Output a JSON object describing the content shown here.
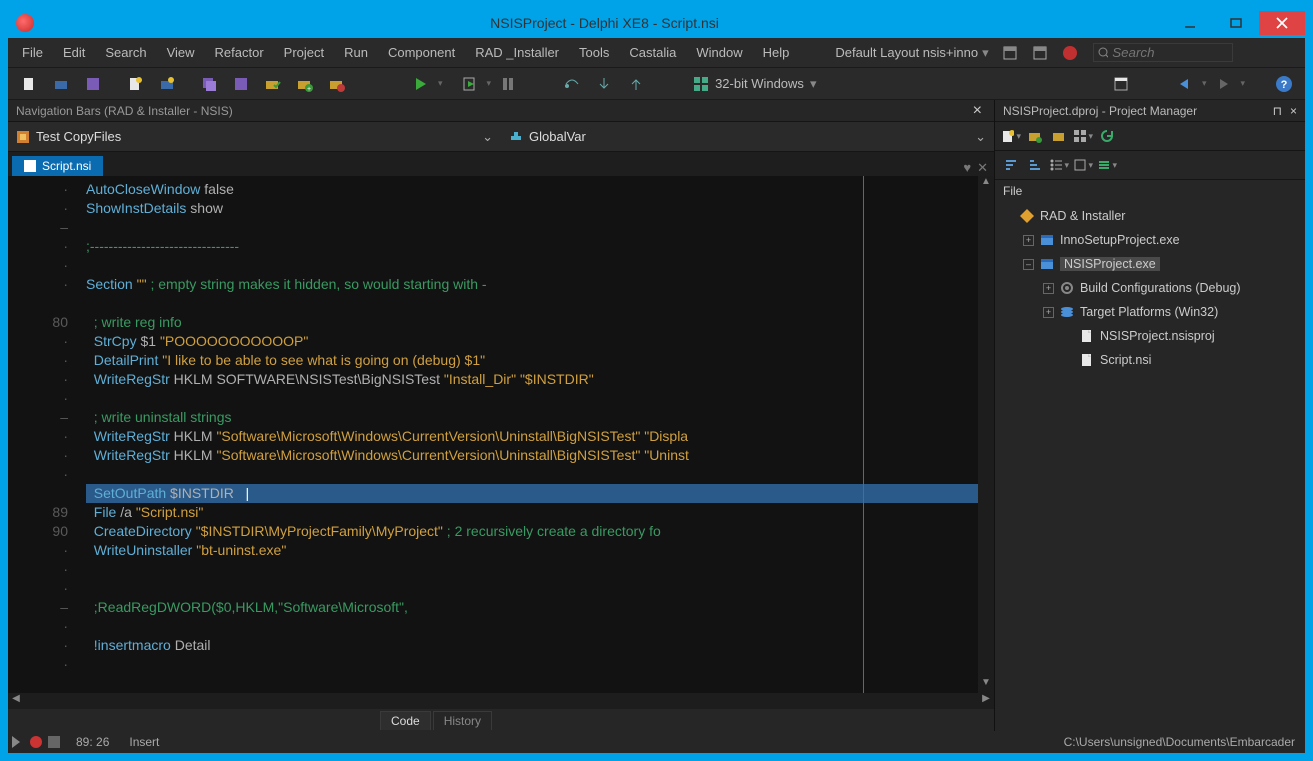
{
  "window": {
    "title": "NSISProject - Delphi XE8 - Script.nsi"
  },
  "menu": [
    "File",
    "Edit",
    "Search",
    "View",
    "Refactor",
    "Project",
    "Run",
    "Component",
    "RAD _Installer",
    "Tools",
    "Castalia",
    "Window",
    "Help"
  ],
  "layout_combo": "Default Layout nsis+inno",
  "search_placeholder": "Search",
  "platform": "32-bit Windows",
  "nav_panel_title": "Navigation Bars (RAD & Installer - NSIS)",
  "nav_left": "Test CopyFiles",
  "nav_right": "GlobalVar",
  "active_tab": "Script.nsi",
  "gutter": [
    "·",
    "·",
    "–",
    "·",
    "·",
    "·",
    "",
    "80",
    "·",
    "·",
    "·",
    "·",
    "–",
    "·",
    "·",
    "·",
    "",
    "89",
    "90",
    "·",
    "·",
    "·",
    "–",
    "·",
    "·",
    "·"
  ],
  "code": [
    [
      [
        "k",
        "AutoCloseWindow"
      ],
      [
        "kw",
        " false"
      ]
    ],
    [
      [
        "k",
        "ShowInstDetails"
      ],
      [
        "kw",
        " show"
      ]
    ],
    [],
    [
      [
        "c",
        ";--------------------------------"
      ]
    ],
    [],
    [
      [
        "k",
        "Section"
      ],
      [
        "kw",
        " "
      ],
      [
        "s",
        "\"\""
      ],
      [
        "kw",
        " "
      ],
      [
        "c",
        "; empty string makes it hidden, so would starting with -"
      ]
    ],
    [],
    [
      [
        "kw",
        "  "
      ],
      [
        "c",
        "; write reg info"
      ]
    ],
    [
      [
        "kw",
        "  "
      ],
      [
        "k",
        "StrCpy"
      ],
      [
        "kw",
        " $1 "
      ],
      [
        "s",
        "\"POOOOOOOOOOOP\""
      ]
    ],
    [
      [
        "kw",
        "  "
      ],
      [
        "k",
        "DetailPrint"
      ],
      [
        "kw",
        " "
      ],
      [
        "s",
        "\"I like to be able to see what is going on (debug) $1\""
      ]
    ],
    [
      [
        "kw",
        "  "
      ],
      [
        "k",
        "WriteRegStr"
      ],
      [
        "kw",
        " HKLM SOFTWARE\\NSISTest\\BigNSISTest "
      ],
      [
        "s",
        "\"Install_Dir\""
      ],
      [
        "kw",
        " "
      ],
      [
        "s",
        "\"$INSTDIR\""
      ]
    ],
    [],
    [
      [
        "kw",
        "  "
      ],
      [
        "c",
        "; write uninstall strings"
      ]
    ],
    [
      [
        "kw",
        "  "
      ],
      [
        "k",
        "WriteRegStr"
      ],
      [
        "kw",
        " HKLM "
      ],
      [
        "s",
        "\"Software\\Microsoft\\Windows\\CurrentVersion\\Uninstall\\BigNSISTest\""
      ],
      [
        "kw",
        " "
      ],
      [
        "s",
        "\"Displa"
      ]
    ],
    [
      [
        "kw",
        "  "
      ],
      [
        "k",
        "WriteRegStr"
      ],
      [
        "kw",
        " HKLM "
      ],
      [
        "s",
        "\"Software\\Microsoft\\Windows\\CurrentVersion\\Uninstall\\BigNSISTest\""
      ],
      [
        "kw",
        " "
      ],
      [
        "s",
        "\"Uninst"
      ]
    ],
    [],
    [
      [
        "kw",
        "  "
      ],
      [
        "k",
        "SetOutPath"
      ],
      [
        "kw",
        " $INSTDIR   "
      ]
    ],
    [
      [
        "kw",
        "  "
      ],
      [
        "k",
        "File"
      ],
      [
        "kw",
        " /a "
      ],
      [
        "s",
        "\"Script.nsi\""
      ]
    ],
    [
      [
        "kw",
        "  "
      ],
      [
        "k",
        "CreateDirectory"
      ],
      [
        "kw",
        " "
      ],
      [
        "s",
        "\"$INSTDIR\\MyProjectFamily\\MyProject\""
      ],
      [
        "kw",
        " "
      ],
      [
        "c",
        "; 2 recursively create a directory fo"
      ]
    ],
    [
      [
        "kw",
        "  "
      ],
      [
        "k",
        "WriteUninstaller"
      ],
      [
        "kw",
        " "
      ],
      [
        "s",
        "\"bt-uninst.exe\""
      ]
    ],
    [],
    [],
    [
      [
        "kw",
        "  "
      ],
      [
        "c",
        ";ReadRegDWORD($0,HKLM,\"Software\\Microsoft\","
      ]
    ],
    [],
    [
      [
        "kw",
        "  "
      ],
      [
        "k",
        "!insertmacro"
      ],
      [
        "kw",
        " Detail"
      ]
    ],
    []
  ],
  "highlighted_line_index": 16,
  "bottom_tabs": {
    "active": "Code",
    "inactive": "History"
  },
  "status": {
    "pos": "89: 26",
    "mode": "Insert",
    "path": "C:\\Users\\unsigned\\Documents\\Embarcader"
  },
  "pm": {
    "header": "NSISProject.dproj - Project Manager",
    "section": "File",
    "tree": [
      {
        "lvl": 0,
        "tw": "",
        "icon": "diamond",
        "label": "RAD & Installer"
      },
      {
        "lvl": 1,
        "tw": "+",
        "icon": "exe",
        "label": "InnoSetupProject.exe"
      },
      {
        "lvl": 1,
        "tw": "–",
        "icon": "exe",
        "label": "NSISProject.exe",
        "sel": true
      },
      {
        "lvl": 2,
        "tw": "+",
        "icon": "gear",
        "label": "Build Configurations (Debug)"
      },
      {
        "lvl": 2,
        "tw": "+",
        "icon": "stack",
        "label": "Target Platforms (Win32)"
      },
      {
        "lvl": 3,
        "tw": "",
        "icon": "file",
        "label": "NSISProject.nsisproj"
      },
      {
        "lvl": 3,
        "tw": "",
        "icon": "file",
        "label": "Script.nsi"
      }
    ]
  }
}
